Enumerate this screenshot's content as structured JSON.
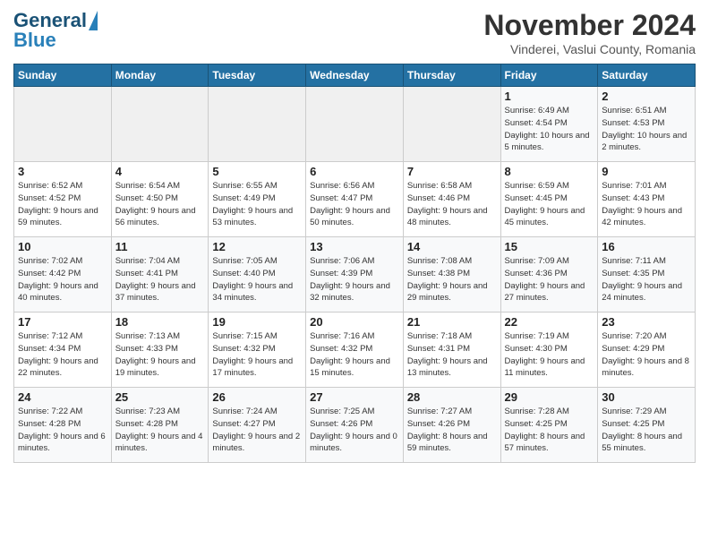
{
  "header": {
    "logo_line1": "General",
    "logo_line2": "Blue",
    "month": "November 2024",
    "location": "Vinderei, Vaslui County, Romania"
  },
  "days_of_week": [
    "Sunday",
    "Monday",
    "Tuesday",
    "Wednesday",
    "Thursday",
    "Friday",
    "Saturday"
  ],
  "weeks": [
    [
      {
        "day": "",
        "info": ""
      },
      {
        "day": "",
        "info": ""
      },
      {
        "day": "",
        "info": ""
      },
      {
        "day": "",
        "info": ""
      },
      {
        "day": "",
        "info": ""
      },
      {
        "day": "1",
        "info": "Sunrise: 6:49 AM\nSunset: 4:54 PM\nDaylight: 10 hours\nand 5 minutes."
      },
      {
        "day": "2",
        "info": "Sunrise: 6:51 AM\nSunset: 4:53 PM\nDaylight: 10 hours\nand 2 minutes."
      }
    ],
    [
      {
        "day": "3",
        "info": "Sunrise: 6:52 AM\nSunset: 4:52 PM\nDaylight: 9 hours\nand 59 minutes."
      },
      {
        "day": "4",
        "info": "Sunrise: 6:54 AM\nSunset: 4:50 PM\nDaylight: 9 hours\nand 56 minutes."
      },
      {
        "day": "5",
        "info": "Sunrise: 6:55 AM\nSunset: 4:49 PM\nDaylight: 9 hours\nand 53 minutes."
      },
      {
        "day": "6",
        "info": "Sunrise: 6:56 AM\nSunset: 4:47 PM\nDaylight: 9 hours\nand 50 minutes."
      },
      {
        "day": "7",
        "info": "Sunrise: 6:58 AM\nSunset: 4:46 PM\nDaylight: 9 hours\nand 48 minutes."
      },
      {
        "day": "8",
        "info": "Sunrise: 6:59 AM\nSunset: 4:45 PM\nDaylight: 9 hours\nand 45 minutes."
      },
      {
        "day": "9",
        "info": "Sunrise: 7:01 AM\nSunset: 4:43 PM\nDaylight: 9 hours\nand 42 minutes."
      }
    ],
    [
      {
        "day": "10",
        "info": "Sunrise: 7:02 AM\nSunset: 4:42 PM\nDaylight: 9 hours\nand 40 minutes."
      },
      {
        "day": "11",
        "info": "Sunrise: 7:04 AM\nSunset: 4:41 PM\nDaylight: 9 hours\nand 37 minutes."
      },
      {
        "day": "12",
        "info": "Sunrise: 7:05 AM\nSunset: 4:40 PM\nDaylight: 9 hours\nand 34 minutes."
      },
      {
        "day": "13",
        "info": "Sunrise: 7:06 AM\nSunset: 4:39 PM\nDaylight: 9 hours\nand 32 minutes."
      },
      {
        "day": "14",
        "info": "Sunrise: 7:08 AM\nSunset: 4:38 PM\nDaylight: 9 hours\nand 29 minutes."
      },
      {
        "day": "15",
        "info": "Sunrise: 7:09 AM\nSunset: 4:36 PM\nDaylight: 9 hours\nand 27 minutes."
      },
      {
        "day": "16",
        "info": "Sunrise: 7:11 AM\nSunset: 4:35 PM\nDaylight: 9 hours\nand 24 minutes."
      }
    ],
    [
      {
        "day": "17",
        "info": "Sunrise: 7:12 AM\nSunset: 4:34 PM\nDaylight: 9 hours\nand 22 minutes."
      },
      {
        "day": "18",
        "info": "Sunrise: 7:13 AM\nSunset: 4:33 PM\nDaylight: 9 hours\nand 19 minutes."
      },
      {
        "day": "19",
        "info": "Sunrise: 7:15 AM\nSunset: 4:32 PM\nDaylight: 9 hours\nand 17 minutes."
      },
      {
        "day": "20",
        "info": "Sunrise: 7:16 AM\nSunset: 4:32 PM\nDaylight: 9 hours\nand 15 minutes."
      },
      {
        "day": "21",
        "info": "Sunrise: 7:18 AM\nSunset: 4:31 PM\nDaylight: 9 hours\nand 13 minutes."
      },
      {
        "day": "22",
        "info": "Sunrise: 7:19 AM\nSunset: 4:30 PM\nDaylight: 9 hours\nand 11 minutes."
      },
      {
        "day": "23",
        "info": "Sunrise: 7:20 AM\nSunset: 4:29 PM\nDaylight: 9 hours\nand 8 minutes."
      }
    ],
    [
      {
        "day": "24",
        "info": "Sunrise: 7:22 AM\nSunset: 4:28 PM\nDaylight: 9 hours\nand 6 minutes."
      },
      {
        "day": "25",
        "info": "Sunrise: 7:23 AM\nSunset: 4:28 PM\nDaylight: 9 hours\nand 4 minutes."
      },
      {
        "day": "26",
        "info": "Sunrise: 7:24 AM\nSunset: 4:27 PM\nDaylight: 9 hours\nand 2 minutes."
      },
      {
        "day": "27",
        "info": "Sunrise: 7:25 AM\nSunset: 4:26 PM\nDaylight: 9 hours\nand 0 minutes."
      },
      {
        "day": "28",
        "info": "Sunrise: 7:27 AM\nSunset: 4:26 PM\nDaylight: 8 hours\nand 59 minutes."
      },
      {
        "day": "29",
        "info": "Sunrise: 7:28 AM\nSunset: 4:25 PM\nDaylight: 8 hours\nand 57 minutes."
      },
      {
        "day": "30",
        "info": "Sunrise: 7:29 AM\nSunset: 4:25 PM\nDaylight: 8 hours\nand 55 minutes."
      }
    ]
  ]
}
